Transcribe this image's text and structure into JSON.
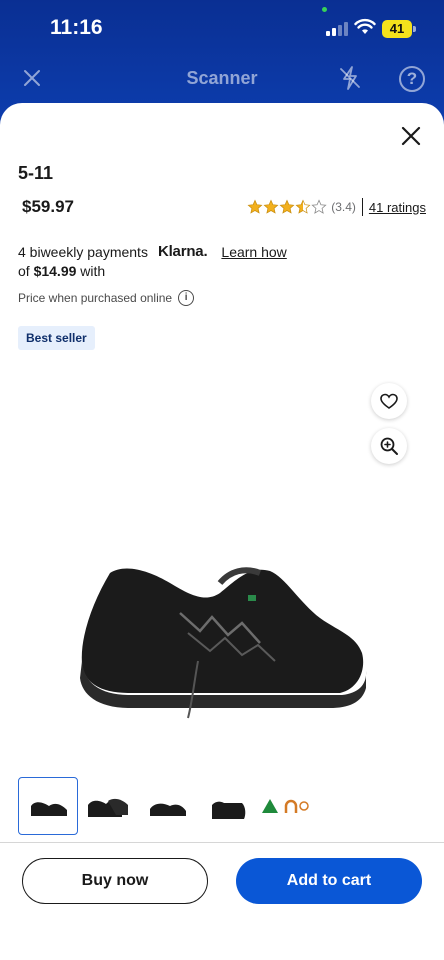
{
  "status_bar": {
    "time": "11:16",
    "battery": "41"
  },
  "header": {
    "title": "Scanner"
  },
  "product": {
    "brand": "5-11",
    "price": "$59.97",
    "rating_value": "(3.4)",
    "rating_stars": 3.4,
    "ratings_link": "41 ratings",
    "badge": "Best seller"
  },
  "klarna": {
    "line1": "4 biweekly payments",
    "logo": "Klarna.",
    "learn": "Learn how",
    "line2_prefix": "of ",
    "line2_amount": "$14.99",
    "line2_suffix": " with"
  },
  "price_note": "Price when purchased online",
  "actions": {
    "buy_now": "Buy now",
    "add_to_cart": "Add to cart"
  },
  "colors": {
    "primary_blue": "#0a57d6",
    "header_blue": "#0c3aa6",
    "star": "#f2b01e"
  }
}
